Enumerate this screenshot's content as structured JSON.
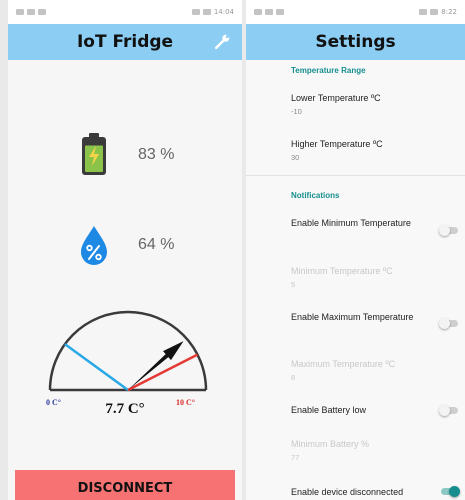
{
  "left_screen": {
    "status_time": "14:04",
    "app_title": "IoT Fridge",
    "battery": {
      "value": "83 %",
      "level": 0.83,
      "color": "#8bc34a"
    },
    "humidity": {
      "value": "64 %"
    },
    "gauge": {
      "min_label": "0 C°",
      "max_label": "10 C°",
      "value_label": "7.7 C°",
      "value": 7.7,
      "lower_limit": -10,
      "higher_limit": 30,
      "colors": {
        "low": "#29a8e8",
        "high": "#e53935",
        "needle": "#111111"
      }
    },
    "disconnect_label": "DISCONNECT"
  },
  "right_screen": {
    "status_time": "8:22",
    "title": "Settings",
    "temperature_range": {
      "header": "Temperature Range",
      "lower": {
        "label": "Lower Temperature ºC",
        "value": "-10"
      },
      "higher": {
        "label": "Higher Temperature ºC",
        "value": "30"
      }
    },
    "notifications": {
      "header": "Notifications",
      "enable_min": {
        "label": "Enable Minimum Temperature",
        "on": false
      },
      "min_temp": {
        "label": "Minimum Temperature ºC",
        "value": "5"
      },
      "enable_max": {
        "label": "Enable Maximum Temperature",
        "on": false
      },
      "max_temp": {
        "label": "Maximum Temperature ºC",
        "value": "8"
      },
      "enable_battery": {
        "label": "Enable Battery low",
        "on": false
      },
      "min_battery": {
        "label": "Minimum Battery %",
        "value": "77"
      },
      "enable_disconnected": {
        "label": "Enable device disconnected",
        "on": true
      }
    },
    "accent_color": "#178e8e"
  }
}
